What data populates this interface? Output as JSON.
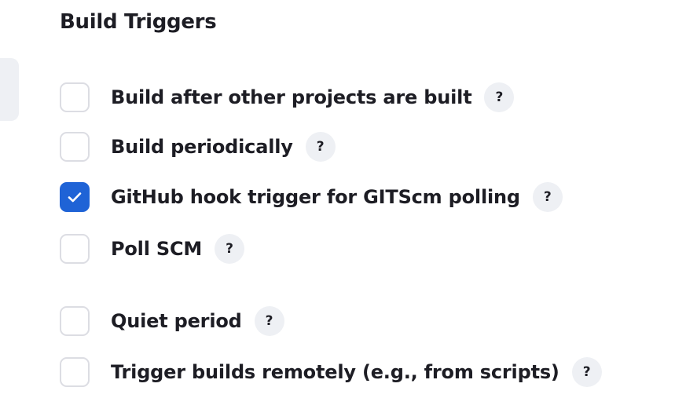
{
  "section": {
    "title": "Build Triggers"
  },
  "help_glyph": "?",
  "icons": {
    "checked": "checkmark-icon",
    "help": "question-mark-icon"
  },
  "colors": {
    "accent": "#1f63d6",
    "checkbox_border": "#dcdde3",
    "help_bg": "#eef0f4",
    "text": "#1d1d24"
  },
  "triggers": [
    {
      "label": "Build after other projects are built",
      "checked": false
    },
    {
      "label": "Build periodically",
      "checked": false
    },
    {
      "label": "GitHub hook trigger for GITScm polling",
      "checked": true
    },
    {
      "label": "Poll SCM",
      "checked": false
    },
    {
      "label": "Quiet period",
      "checked": false
    },
    {
      "label": "Trigger builds remotely (e.g., from scripts)",
      "checked": false
    }
  ]
}
